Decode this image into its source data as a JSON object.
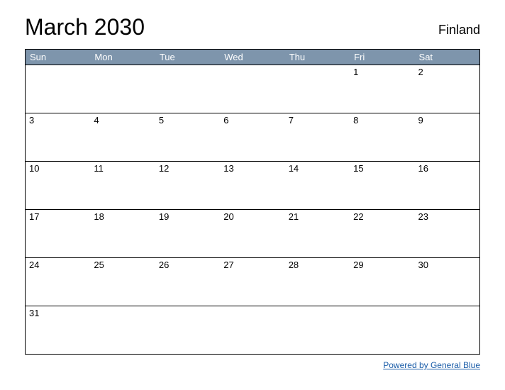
{
  "header": {
    "title": "March 2030",
    "country": "Finland"
  },
  "days": [
    "Sun",
    "Mon",
    "Tue",
    "Wed",
    "Thu",
    "Fri",
    "Sat"
  ],
  "weeks": [
    [
      "",
      "",
      "",
      "",
      "",
      "1",
      "2"
    ],
    [
      "3",
      "4",
      "5",
      "6",
      "7",
      "8",
      "9"
    ],
    [
      "10",
      "11",
      "12",
      "13",
      "14",
      "15",
      "16"
    ],
    [
      "17",
      "18",
      "19",
      "20",
      "21",
      "22",
      "23"
    ],
    [
      "24",
      "25",
      "26",
      "27",
      "28",
      "29",
      "30"
    ],
    [
      "31",
      "",
      "",
      "",
      "",
      "",
      ""
    ]
  ],
  "footer": {
    "link_text": "Powered by General Blue"
  }
}
